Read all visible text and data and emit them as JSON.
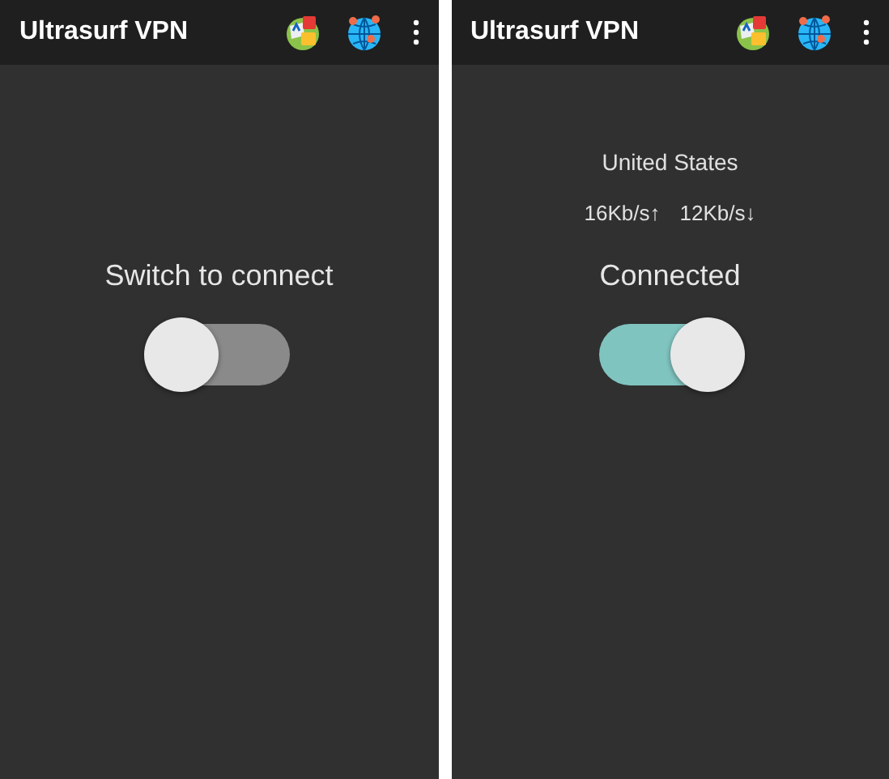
{
  "screens": [
    {
      "app_bar": {
        "title": "Ultrasurf VPN"
      },
      "label": "Switch to connect",
      "switch": {
        "on": false
      }
    },
    {
      "app_bar": {
        "title": "Ultrasurf VPN"
      },
      "status": {
        "country": "United States",
        "upload": "16Kb/s↑",
        "download": "12Kb/s↓"
      },
      "label": "Connected",
      "switch": {
        "on": true
      }
    }
  ]
}
